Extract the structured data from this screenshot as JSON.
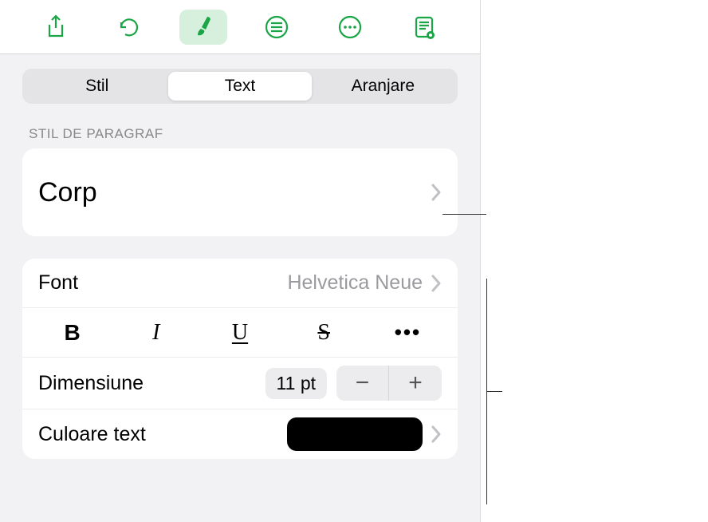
{
  "toolbar": {
    "icons": [
      "share",
      "undo",
      "format",
      "insert",
      "more",
      "reader"
    ]
  },
  "tabs": {
    "items": [
      "Stil",
      "Text",
      "Aranjare"
    ],
    "selected_index": 1
  },
  "paragraph_style": {
    "section_label": "STIL DE PARAGRAF",
    "value": "Corp"
  },
  "font": {
    "label": "Font",
    "value": "Helvetica Neue"
  },
  "format_buttons": {
    "bold": "B",
    "italic": "I",
    "underline": "U",
    "strike": "S",
    "more": "•••"
  },
  "size": {
    "label": "Dimensiune",
    "value": "11 pt",
    "minus": "−",
    "plus": "+"
  },
  "text_color": {
    "label": "Culoare text",
    "value": "#000000"
  }
}
